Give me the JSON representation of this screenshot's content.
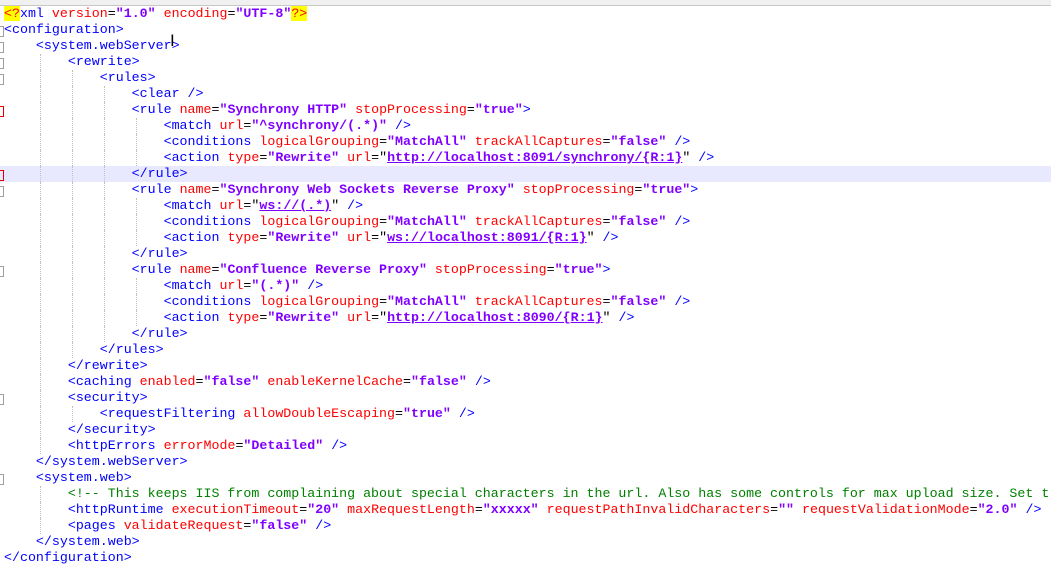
{
  "editor": {
    "highlighted_line": 11,
    "lines": [
      {
        "indent": 0,
        "fold": false,
        "tokens": [
          [
            "p",
            "<?"
          ],
          [
            "x",
            "xml "
          ],
          [
            "a",
            "version"
          ],
          [
            "q",
            "="
          ],
          [
            "v",
            "\"1.0\""
          ],
          [
            "q",
            " "
          ],
          [
            "a",
            "encoding"
          ],
          [
            "q",
            "="
          ],
          [
            "v",
            "\"UTF-8\""
          ],
          [
            "p",
            "?>"
          ]
        ]
      },
      {
        "indent": 0,
        "fold": true,
        "tokens": [
          [
            "t",
            "<configuration>"
          ]
        ]
      },
      {
        "indent": 1,
        "fold": true,
        "tokens": [
          [
            "t",
            "<system.webServer>"
          ]
        ]
      },
      {
        "indent": 2,
        "fold": true,
        "tokens": [
          [
            "t",
            "<rewrite>"
          ]
        ]
      },
      {
        "indent": 3,
        "fold": true,
        "tokens": [
          [
            "t",
            "<rules>"
          ]
        ]
      },
      {
        "indent": 4,
        "fold": false,
        "tokens": [
          [
            "t",
            "<clear />"
          ]
        ]
      },
      {
        "indent": 4,
        "fold": true,
        "red": true,
        "tokens": [
          [
            "t",
            "<rule "
          ],
          [
            "a",
            "name"
          ],
          [
            "q",
            "="
          ],
          [
            "v",
            "\"Synchrony HTTP\""
          ],
          [
            "q",
            " "
          ],
          [
            "a",
            "stopProcessing"
          ],
          [
            "q",
            "="
          ],
          [
            "v",
            "\"true\""
          ],
          [
            "t",
            ">"
          ]
        ]
      },
      {
        "indent": 5,
        "fold": false,
        "tokens": [
          [
            "t",
            "<match "
          ],
          [
            "a",
            "url"
          ],
          [
            "q",
            "="
          ],
          [
            "v",
            "\"^synchrony/(.*)\""
          ],
          [
            "t",
            " />"
          ]
        ]
      },
      {
        "indent": 5,
        "fold": false,
        "tokens": [
          [
            "t",
            "<conditions "
          ],
          [
            "a",
            "logicalGrouping"
          ],
          [
            "q",
            "="
          ],
          [
            "v",
            "\"MatchAll\""
          ],
          [
            "q",
            " "
          ],
          [
            "a",
            "trackAllCaptures"
          ],
          [
            "q",
            "="
          ],
          [
            "v",
            "\"false\""
          ],
          [
            "t",
            " />"
          ]
        ]
      },
      {
        "indent": 5,
        "fold": false,
        "tokens": [
          [
            "t",
            "<action "
          ],
          [
            "a",
            "type"
          ],
          [
            "q",
            "="
          ],
          [
            "v",
            "\"Rewrite\""
          ],
          [
            "q",
            " "
          ],
          [
            "a",
            "url"
          ],
          [
            "q",
            "=\""
          ],
          [
            "u",
            "http://localhost:8091/synchrony/{R:1}"
          ],
          [
            "q",
            "\""
          ],
          [
            "t",
            " />"
          ]
        ]
      },
      {
        "indent": 4,
        "fold": false,
        "red": true,
        "tokens": [
          [
            "t",
            "</rule>"
          ]
        ]
      },
      {
        "indent": 4,
        "fold": true,
        "tokens": [
          [
            "t",
            "<rule "
          ],
          [
            "a",
            "name"
          ],
          [
            "q",
            "="
          ],
          [
            "v",
            "\"Synchrony Web Sockets Reverse Proxy\""
          ],
          [
            "q",
            " "
          ],
          [
            "a",
            "stopProcessing"
          ],
          [
            "q",
            "="
          ],
          [
            "v",
            "\"true\""
          ],
          [
            "t",
            ">"
          ]
        ]
      },
      {
        "indent": 5,
        "fold": false,
        "tokens": [
          [
            "t",
            "<match "
          ],
          [
            "a",
            "url"
          ],
          [
            "q",
            "=\""
          ],
          [
            "u",
            "ws://(.*)"
          ],
          [
            "q",
            "\""
          ],
          [
            "t",
            " />"
          ]
        ]
      },
      {
        "indent": 5,
        "fold": false,
        "tokens": [
          [
            "t",
            "<conditions "
          ],
          [
            "a",
            "logicalGrouping"
          ],
          [
            "q",
            "="
          ],
          [
            "v",
            "\"MatchAll\""
          ],
          [
            "q",
            " "
          ],
          [
            "a",
            "trackAllCaptures"
          ],
          [
            "q",
            "="
          ],
          [
            "v",
            "\"false\""
          ],
          [
            "t",
            " />"
          ]
        ]
      },
      {
        "indent": 5,
        "fold": false,
        "tokens": [
          [
            "t",
            "<action "
          ],
          [
            "a",
            "type"
          ],
          [
            "q",
            "="
          ],
          [
            "v",
            "\"Rewrite\""
          ],
          [
            "q",
            " "
          ],
          [
            "a",
            "url"
          ],
          [
            "q",
            "=\""
          ],
          [
            "u",
            "ws://localhost:8091/{R:1}"
          ],
          [
            "q",
            "\""
          ],
          [
            "t",
            " />"
          ]
        ]
      },
      {
        "indent": 4,
        "fold": false,
        "tokens": [
          [
            "t",
            "</rule>"
          ]
        ]
      },
      {
        "indent": 4,
        "fold": true,
        "tokens": [
          [
            "t",
            "<rule "
          ],
          [
            "a",
            "name"
          ],
          [
            "q",
            "="
          ],
          [
            "v",
            "\"Confluence Reverse Proxy\""
          ],
          [
            "q",
            " "
          ],
          [
            "a",
            "stopProcessing"
          ],
          [
            "q",
            "="
          ],
          [
            "v",
            "\"true\""
          ],
          [
            "t",
            ">"
          ]
        ]
      },
      {
        "indent": 5,
        "fold": false,
        "tokens": [
          [
            "t",
            "<match "
          ],
          [
            "a",
            "url"
          ],
          [
            "q",
            "="
          ],
          [
            "v",
            "\"(.*)\""
          ],
          [
            "t",
            " />"
          ]
        ]
      },
      {
        "indent": 5,
        "fold": false,
        "tokens": [
          [
            "t",
            "<conditions "
          ],
          [
            "a",
            "logicalGrouping"
          ],
          [
            "q",
            "="
          ],
          [
            "v",
            "\"MatchAll\""
          ],
          [
            "q",
            " "
          ],
          [
            "a",
            "trackAllCaptures"
          ],
          [
            "q",
            "="
          ],
          [
            "v",
            "\"false\""
          ],
          [
            "t",
            " />"
          ]
        ]
      },
      {
        "indent": 5,
        "fold": false,
        "tokens": [
          [
            "t",
            "<action "
          ],
          [
            "a",
            "type"
          ],
          [
            "q",
            "="
          ],
          [
            "v",
            "\"Rewrite\""
          ],
          [
            "q",
            " "
          ],
          [
            "a",
            "url"
          ],
          [
            "q",
            "=\""
          ],
          [
            "u",
            "http://localhost:8090/{R:1}"
          ],
          [
            "q",
            "\""
          ],
          [
            "t",
            " />"
          ]
        ]
      },
      {
        "indent": 4,
        "fold": false,
        "tokens": [
          [
            "t",
            "</rule>"
          ]
        ]
      },
      {
        "indent": 3,
        "fold": false,
        "tokens": [
          [
            "t",
            "</rules>"
          ]
        ]
      },
      {
        "indent": 2,
        "fold": false,
        "tokens": [
          [
            "t",
            "</rewrite>"
          ]
        ]
      },
      {
        "indent": 2,
        "fold": false,
        "tokens": [
          [
            "t",
            "<caching "
          ],
          [
            "a",
            "enabled"
          ],
          [
            "q",
            "="
          ],
          [
            "v",
            "\"false\""
          ],
          [
            "q",
            " "
          ],
          [
            "a",
            "enableKernelCache"
          ],
          [
            "q",
            "="
          ],
          [
            "v",
            "\"false\""
          ],
          [
            "t",
            " />"
          ]
        ]
      },
      {
        "indent": 2,
        "fold": true,
        "tokens": [
          [
            "t",
            "<security>"
          ]
        ]
      },
      {
        "indent": 3,
        "fold": false,
        "tokens": [
          [
            "t",
            "<requestFiltering "
          ],
          [
            "a",
            "allowDoubleEscaping"
          ],
          [
            "q",
            "="
          ],
          [
            "v",
            "\"true\""
          ],
          [
            "t",
            " />"
          ]
        ]
      },
      {
        "indent": 2,
        "fold": false,
        "tokens": [
          [
            "t",
            "</security>"
          ]
        ]
      },
      {
        "indent": 2,
        "fold": false,
        "tokens": [
          [
            "t",
            "<httpErrors "
          ],
          [
            "a",
            "errorMode"
          ],
          [
            "q",
            "="
          ],
          [
            "v",
            "\"Detailed\""
          ],
          [
            "t",
            " />"
          ]
        ]
      },
      {
        "indent": 1,
        "fold": false,
        "tokens": [
          [
            "t",
            "</system.webServer>"
          ]
        ]
      },
      {
        "indent": 1,
        "fold": true,
        "tokens": [
          [
            "t",
            "<system.web>"
          ]
        ]
      },
      {
        "indent": 2,
        "fold": false,
        "tokens": [
          [
            "c",
            "<!-- This keeps IIS from complaining about special characters in the url. Also has some controls for max upload size. Set t"
          ]
        ]
      },
      {
        "indent": 2,
        "fold": false,
        "tokens": [
          [
            "t",
            "<httpRuntime "
          ],
          [
            "a",
            "executionTimeout"
          ],
          [
            "q",
            "="
          ],
          [
            "v",
            "\"20\""
          ],
          [
            "q",
            " "
          ],
          [
            "a",
            "maxRequestLength"
          ],
          [
            "q",
            "="
          ],
          [
            "v",
            "\"xxxxx\""
          ],
          [
            "q",
            " "
          ],
          [
            "a",
            "requestPathInvalidCharacters"
          ],
          [
            "q",
            "="
          ],
          [
            "v",
            "\"\""
          ],
          [
            "q",
            " "
          ],
          [
            "a",
            "requestValidationMode"
          ],
          [
            "q",
            "="
          ],
          [
            "v",
            "\"2.0\""
          ],
          [
            "t",
            " />"
          ]
        ]
      },
      {
        "indent": 2,
        "fold": false,
        "tokens": [
          [
            "t",
            "<pages "
          ],
          [
            "a",
            "validateRequest"
          ],
          [
            "q",
            "="
          ],
          [
            "v",
            "\"false\""
          ],
          [
            "t",
            " />"
          ]
        ]
      },
      {
        "indent": 1,
        "fold": false,
        "tokens": [
          [
            "t",
            "</system.web>"
          ]
        ]
      },
      {
        "indent": 0,
        "fold": false,
        "tokens": [
          [
            "t",
            "</configuration>"
          ]
        ]
      }
    ]
  }
}
